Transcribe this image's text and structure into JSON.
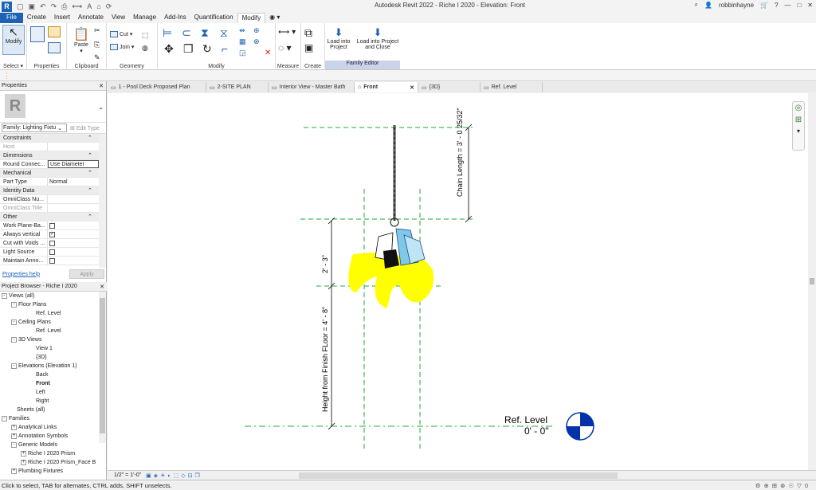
{
  "window_title": "Autodesk Revit 2022 - Riche I 2020 - Elevation: Front",
  "user": "robbinhayne",
  "ribbon_tabs": [
    "File",
    "Create",
    "Insert",
    "Annotate",
    "View",
    "Manage",
    "Add-Ins",
    "Quantification",
    "Modify"
  ],
  "ribbon": {
    "modify": "Modify",
    "select": "Select",
    "properties": "Properties",
    "paste": "Paste",
    "clipboard": "Clipboard",
    "cut": "Cut",
    "join": "Join",
    "geometry": "Geometry",
    "modify_panel": "Modify",
    "measure": "Measure",
    "create": "Create",
    "load_into_project": "Load into Project",
    "load_into_project_close": "Load into Project and Close",
    "family_editor": "Family Editor"
  },
  "properties": {
    "header": "Properties",
    "type_selector": "Family: Lighting Fixtu",
    "edit_type": "Edit Type",
    "groups": {
      "constraints": "Constraints",
      "dimensions": "Dimensions",
      "mechanical": "Mechanical",
      "identity": "Identity Data",
      "other": "Other"
    },
    "rows": {
      "host": "Host",
      "round_connector": "Round Connec...",
      "round_connector_value": "Use Diameter",
      "part_type": "Part Type",
      "part_type_value": "Normal",
      "omniclass_number": "OmniClass Nu...",
      "omniclass_title": "OmniClass Title",
      "work_plane": "Work Plane-Ba...",
      "always_vertical": "Always vertical",
      "cut_with_voids": "Cut with Voids ...",
      "light_source": "Light Source",
      "maintain_anno": "Maintain Anno..."
    },
    "help": "Properties help",
    "apply": "Apply"
  },
  "project_browser": {
    "header": "Project Browser - Riche I 2020",
    "nodes": [
      {
        "label": "Views (all)",
        "indent": 0,
        "exp": "-"
      },
      {
        "label": "Floor Plans",
        "indent": 1,
        "exp": "-"
      },
      {
        "label": "Ref. Level",
        "indent": 2,
        "exp": ""
      },
      {
        "label": "Ceiling Plans",
        "indent": 1,
        "exp": "-"
      },
      {
        "label": "Ref. Level",
        "indent": 2,
        "exp": ""
      },
      {
        "label": "3D Views",
        "indent": 1,
        "exp": "-"
      },
      {
        "label": "View 1",
        "indent": 2,
        "exp": ""
      },
      {
        "label": "{3D}",
        "indent": 2,
        "exp": ""
      },
      {
        "label": "Elevations (Elevation 1)",
        "indent": 1,
        "exp": "-"
      },
      {
        "label": "Back",
        "indent": 2,
        "exp": ""
      },
      {
        "label": "Front",
        "indent": 2,
        "exp": "",
        "bold": true
      },
      {
        "label": "Left",
        "indent": 2,
        "exp": ""
      },
      {
        "label": "Right",
        "indent": 2,
        "exp": ""
      },
      {
        "label": "Sheets (all)",
        "indent": 0,
        "exp": ""
      },
      {
        "label": "Families",
        "indent": 0,
        "exp": "-"
      },
      {
        "label": "Analytical Links",
        "indent": 1,
        "exp": "+"
      },
      {
        "label": "Annotation Symbols",
        "indent": 1,
        "exp": "+"
      },
      {
        "label": "Generic Models",
        "indent": 1,
        "exp": "-"
      },
      {
        "label": "Riche I 2020 Prism",
        "indent": 2,
        "exp": "+"
      },
      {
        "label": "Riche I 2020 Prism_Face B",
        "indent": 2,
        "exp": "+"
      },
      {
        "label": "Plumbing Fixtures",
        "indent": 1,
        "exp": "+"
      }
    ]
  },
  "view_tabs": [
    {
      "label": "1 - Pool Deck Proposed Plan",
      "w": 124
    },
    {
      "label": "2-SITE PLAN",
      "w": 78
    },
    {
      "label": "Interior View - Master Bath",
      "w": 108
    },
    {
      "label": "Front",
      "w": 80,
      "active": true
    },
    {
      "label": "{3D}",
      "w": 78
    },
    {
      "label": "Ref. Level",
      "w": 78
    }
  ],
  "canvas": {
    "chain_length": "Chain Length = 3' - 0 25/32\"",
    "dim_fixture": "2' - 3\"",
    "height_from_floor": "Height from Finish FLoor = 4' - 8\"",
    "ref_level": "Ref. Level",
    "ref_level_elev": "0' - 0\""
  },
  "scale": "1/2\" = 1'-0\"",
  "status": "Click to select, TAB for alternates, CTRL adds, SHIFT unselects.",
  "colors": {
    "accent": "#1e62b5",
    "ref_plane": "#22aa33",
    "fixture_shade": "#ffff00",
    "glass": "#7fc8ea",
    "ref_marker": "#0033aa"
  }
}
